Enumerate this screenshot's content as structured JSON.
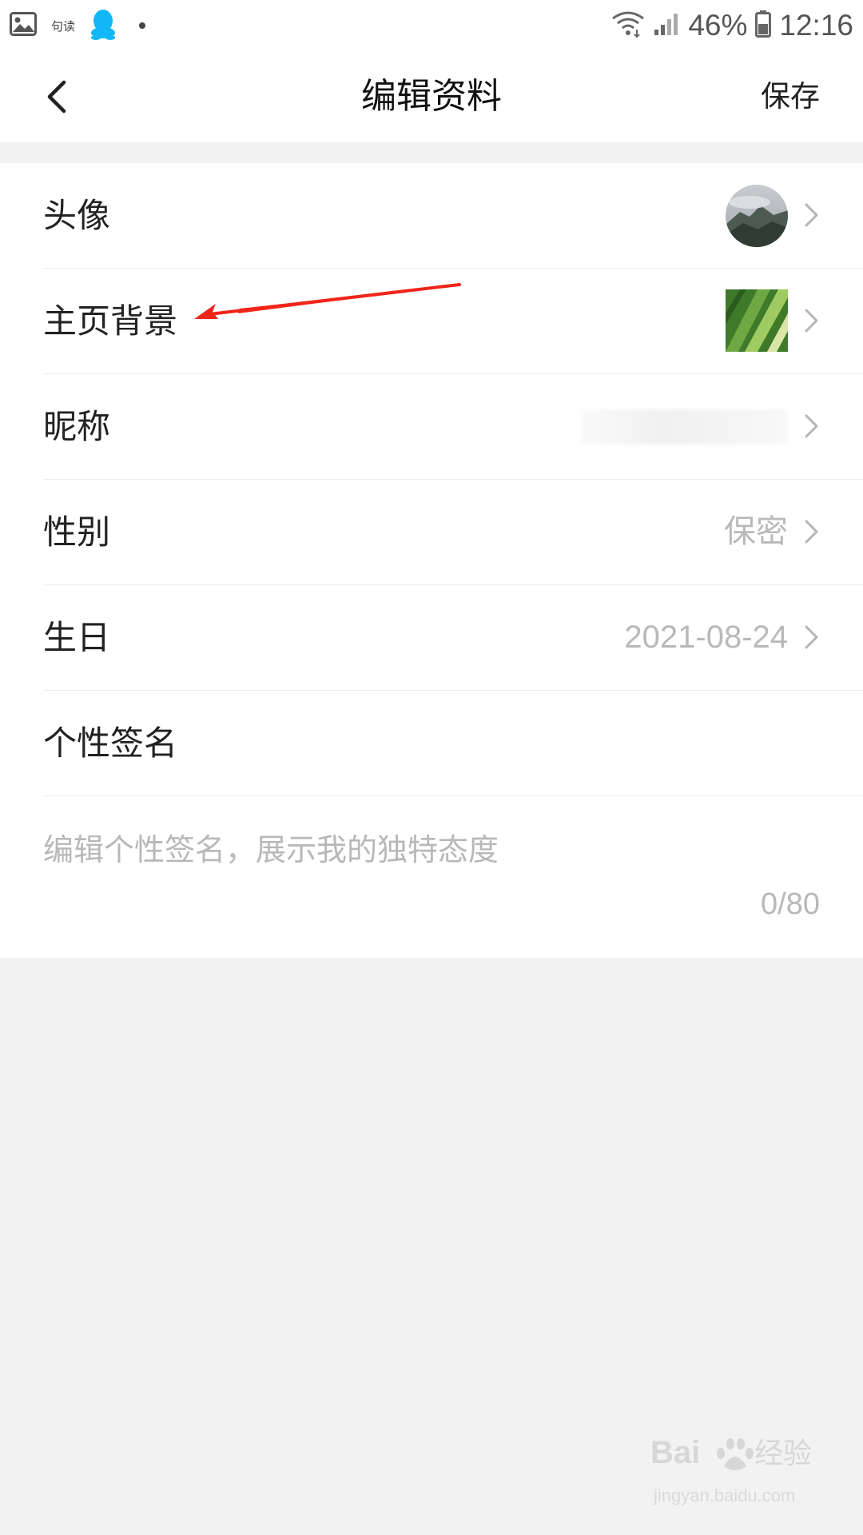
{
  "status_bar": {
    "app_label": "句读",
    "battery": "46%",
    "time": "12:16"
  },
  "header": {
    "title": "编辑资料",
    "save_label": "保存"
  },
  "rows": {
    "avatar": {
      "label": "头像"
    },
    "background": {
      "label": "主页背景"
    },
    "nickname": {
      "label": "昵称"
    },
    "gender": {
      "label": "性别",
      "value": "保密"
    },
    "birthday": {
      "label": "生日",
      "value": "2021-08-24"
    },
    "signature": {
      "label": "个性签名"
    }
  },
  "signature_input": {
    "placeholder": "编辑个性签名，展示我的独特态度",
    "counter": "0/80"
  },
  "watermark": {
    "brand": "Baidu经验",
    "url": "jingyan.baidu.com"
  },
  "colors": {
    "annotation_arrow": "#f0251a",
    "qq_icon": "#12b7f5",
    "placeholder_text": "#b8b8b8",
    "page_background": "#f2f2f2"
  }
}
